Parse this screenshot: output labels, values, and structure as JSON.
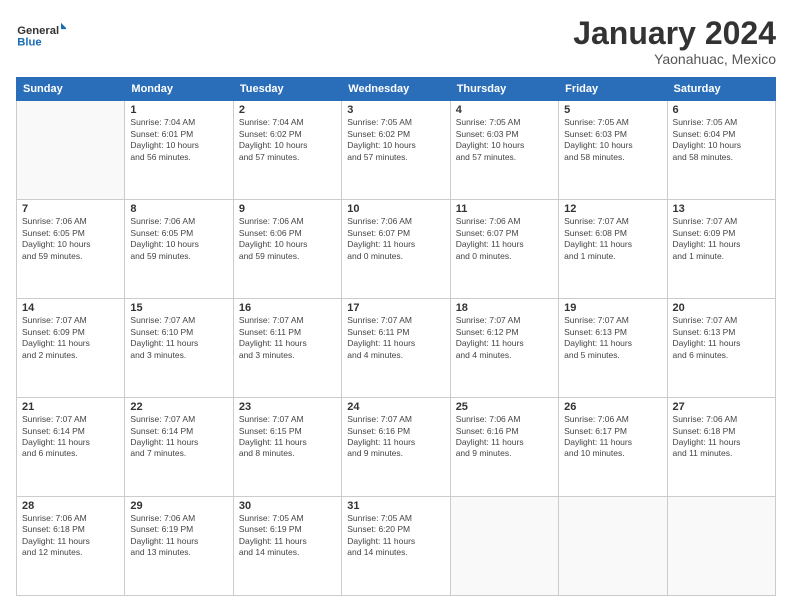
{
  "header": {
    "logo_line1": "General",
    "logo_line2": "Blue",
    "month_title": "January 2024",
    "location": "Yaonahuac, Mexico"
  },
  "weekdays": [
    "Sunday",
    "Monday",
    "Tuesday",
    "Wednesday",
    "Thursday",
    "Friday",
    "Saturday"
  ],
  "weeks": [
    [
      {
        "day": "",
        "info": ""
      },
      {
        "day": "1",
        "info": "Sunrise: 7:04 AM\nSunset: 6:01 PM\nDaylight: 10 hours\nand 56 minutes."
      },
      {
        "day": "2",
        "info": "Sunrise: 7:04 AM\nSunset: 6:02 PM\nDaylight: 10 hours\nand 57 minutes."
      },
      {
        "day": "3",
        "info": "Sunrise: 7:05 AM\nSunset: 6:02 PM\nDaylight: 10 hours\nand 57 minutes."
      },
      {
        "day": "4",
        "info": "Sunrise: 7:05 AM\nSunset: 6:03 PM\nDaylight: 10 hours\nand 57 minutes."
      },
      {
        "day": "5",
        "info": "Sunrise: 7:05 AM\nSunset: 6:03 PM\nDaylight: 10 hours\nand 58 minutes."
      },
      {
        "day": "6",
        "info": "Sunrise: 7:05 AM\nSunset: 6:04 PM\nDaylight: 10 hours\nand 58 minutes."
      }
    ],
    [
      {
        "day": "7",
        "info": "Sunrise: 7:06 AM\nSunset: 6:05 PM\nDaylight: 10 hours\nand 59 minutes."
      },
      {
        "day": "8",
        "info": "Sunrise: 7:06 AM\nSunset: 6:05 PM\nDaylight: 10 hours\nand 59 minutes."
      },
      {
        "day": "9",
        "info": "Sunrise: 7:06 AM\nSunset: 6:06 PM\nDaylight: 10 hours\nand 59 minutes."
      },
      {
        "day": "10",
        "info": "Sunrise: 7:06 AM\nSunset: 6:07 PM\nDaylight: 11 hours\nand 0 minutes."
      },
      {
        "day": "11",
        "info": "Sunrise: 7:06 AM\nSunset: 6:07 PM\nDaylight: 11 hours\nand 0 minutes."
      },
      {
        "day": "12",
        "info": "Sunrise: 7:07 AM\nSunset: 6:08 PM\nDaylight: 11 hours\nand 1 minute."
      },
      {
        "day": "13",
        "info": "Sunrise: 7:07 AM\nSunset: 6:09 PM\nDaylight: 11 hours\nand 1 minute."
      }
    ],
    [
      {
        "day": "14",
        "info": "Sunrise: 7:07 AM\nSunset: 6:09 PM\nDaylight: 11 hours\nand 2 minutes."
      },
      {
        "day": "15",
        "info": "Sunrise: 7:07 AM\nSunset: 6:10 PM\nDaylight: 11 hours\nand 3 minutes."
      },
      {
        "day": "16",
        "info": "Sunrise: 7:07 AM\nSunset: 6:11 PM\nDaylight: 11 hours\nand 3 minutes."
      },
      {
        "day": "17",
        "info": "Sunrise: 7:07 AM\nSunset: 6:11 PM\nDaylight: 11 hours\nand 4 minutes."
      },
      {
        "day": "18",
        "info": "Sunrise: 7:07 AM\nSunset: 6:12 PM\nDaylight: 11 hours\nand 4 minutes."
      },
      {
        "day": "19",
        "info": "Sunrise: 7:07 AM\nSunset: 6:13 PM\nDaylight: 11 hours\nand 5 minutes."
      },
      {
        "day": "20",
        "info": "Sunrise: 7:07 AM\nSunset: 6:13 PM\nDaylight: 11 hours\nand 6 minutes."
      }
    ],
    [
      {
        "day": "21",
        "info": "Sunrise: 7:07 AM\nSunset: 6:14 PM\nDaylight: 11 hours\nand 6 minutes."
      },
      {
        "day": "22",
        "info": "Sunrise: 7:07 AM\nSunset: 6:14 PM\nDaylight: 11 hours\nand 7 minutes."
      },
      {
        "day": "23",
        "info": "Sunrise: 7:07 AM\nSunset: 6:15 PM\nDaylight: 11 hours\nand 8 minutes."
      },
      {
        "day": "24",
        "info": "Sunrise: 7:07 AM\nSunset: 6:16 PM\nDaylight: 11 hours\nand 9 minutes."
      },
      {
        "day": "25",
        "info": "Sunrise: 7:06 AM\nSunset: 6:16 PM\nDaylight: 11 hours\nand 9 minutes."
      },
      {
        "day": "26",
        "info": "Sunrise: 7:06 AM\nSunset: 6:17 PM\nDaylight: 11 hours\nand 10 minutes."
      },
      {
        "day": "27",
        "info": "Sunrise: 7:06 AM\nSunset: 6:18 PM\nDaylight: 11 hours\nand 11 minutes."
      }
    ],
    [
      {
        "day": "28",
        "info": "Sunrise: 7:06 AM\nSunset: 6:18 PM\nDaylight: 11 hours\nand 12 minutes."
      },
      {
        "day": "29",
        "info": "Sunrise: 7:06 AM\nSunset: 6:19 PM\nDaylight: 11 hours\nand 13 minutes."
      },
      {
        "day": "30",
        "info": "Sunrise: 7:05 AM\nSunset: 6:19 PM\nDaylight: 11 hours\nand 14 minutes."
      },
      {
        "day": "31",
        "info": "Sunrise: 7:05 AM\nSunset: 6:20 PM\nDaylight: 11 hours\nand 14 minutes."
      },
      {
        "day": "",
        "info": ""
      },
      {
        "day": "",
        "info": ""
      },
      {
        "day": "",
        "info": ""
      }
    ]
  ]
}
